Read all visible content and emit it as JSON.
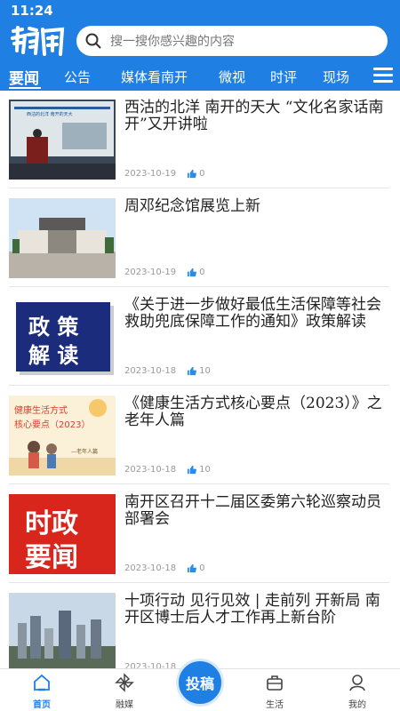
{
  "status": {
    "time": "11:24"
  },
  "app": {
    "logo_text": "南开"
  },
  "search": {
    "placeholder": "搜一搜你感兴趣的内容"
  },
  "tabs": [
    {
      "label": "要闻",
      "active": true
    },
    {
      "label": "公告"
    },
    {
      "label": "媒体看南开"
    },
    {
      "label": "微视"
    },
    {
      "label": "时评"
    },
    {
      "label": "现场"
    }
  ],
  "news": [
    {
      "title": "西沽的北洋 南开的天大 “文化名家话南开”又开讲啦",
      "date": "2023-10-19",
      "likes": "0",
      "thumb_text": "西沽的北洋 南开的天大"
    },
    {
      "title": "周邓纪念馆展览上新",
      "date": "2023-10-19",
      "likes": "0"
    },
    {
      "title": "《关于进一步做好最低生活保障等社会救助兜底保障工作的通知》政策解读",
      "date": "2023-10-18",
      "likes": "10",
      "thumb_line1": "政 策",
      "thumb_line2": "解 读"
    },
    {
      "title": "《健康生活方式核心要点（2023）》之老年人篇",
      "date": "2023-10-18",
      "likes": "10",
      "thumb_line1": "健康生活方式",
      "thumb_line2": "核心要点（2023）",
      "thumb_line3": "—老年人篇"
    },
    {
      "title": "南开区召开十二届区委第六轮巡察动员部署会",
      "date": "2023-10-18",
      "likes": "0",
      "thumb_line1": "时政",
      "thumb_line2": "要闻"
    },
    {
      "title": "十项行动 见行见效 | 走前列 开新局 南开区博士后人才工作再上新台阶",
      "date": "2023-10-18",
      "likes": ""
    }
  ],
  "bottom_nav": {
    "home": "首页",
    "media": "融媒",
    "post": "投稿",
    "life": "生活",
    "mine": "我的"
  },
  "colors": {
    "brand": "#1f7fe3",
    "like_icon": "#2a8be8",
    "thumb_red": "#d8261c",
    "thumb_navy": "#1c2c7c"
  },
  "icons": [
    "search-icon",
    "menu-icon",
    "thumbs-up-icon",
    "home-icon",
    "media-pinwheel-icon",
    "briefcase-icon",
    "user-icon"
  ]
}
